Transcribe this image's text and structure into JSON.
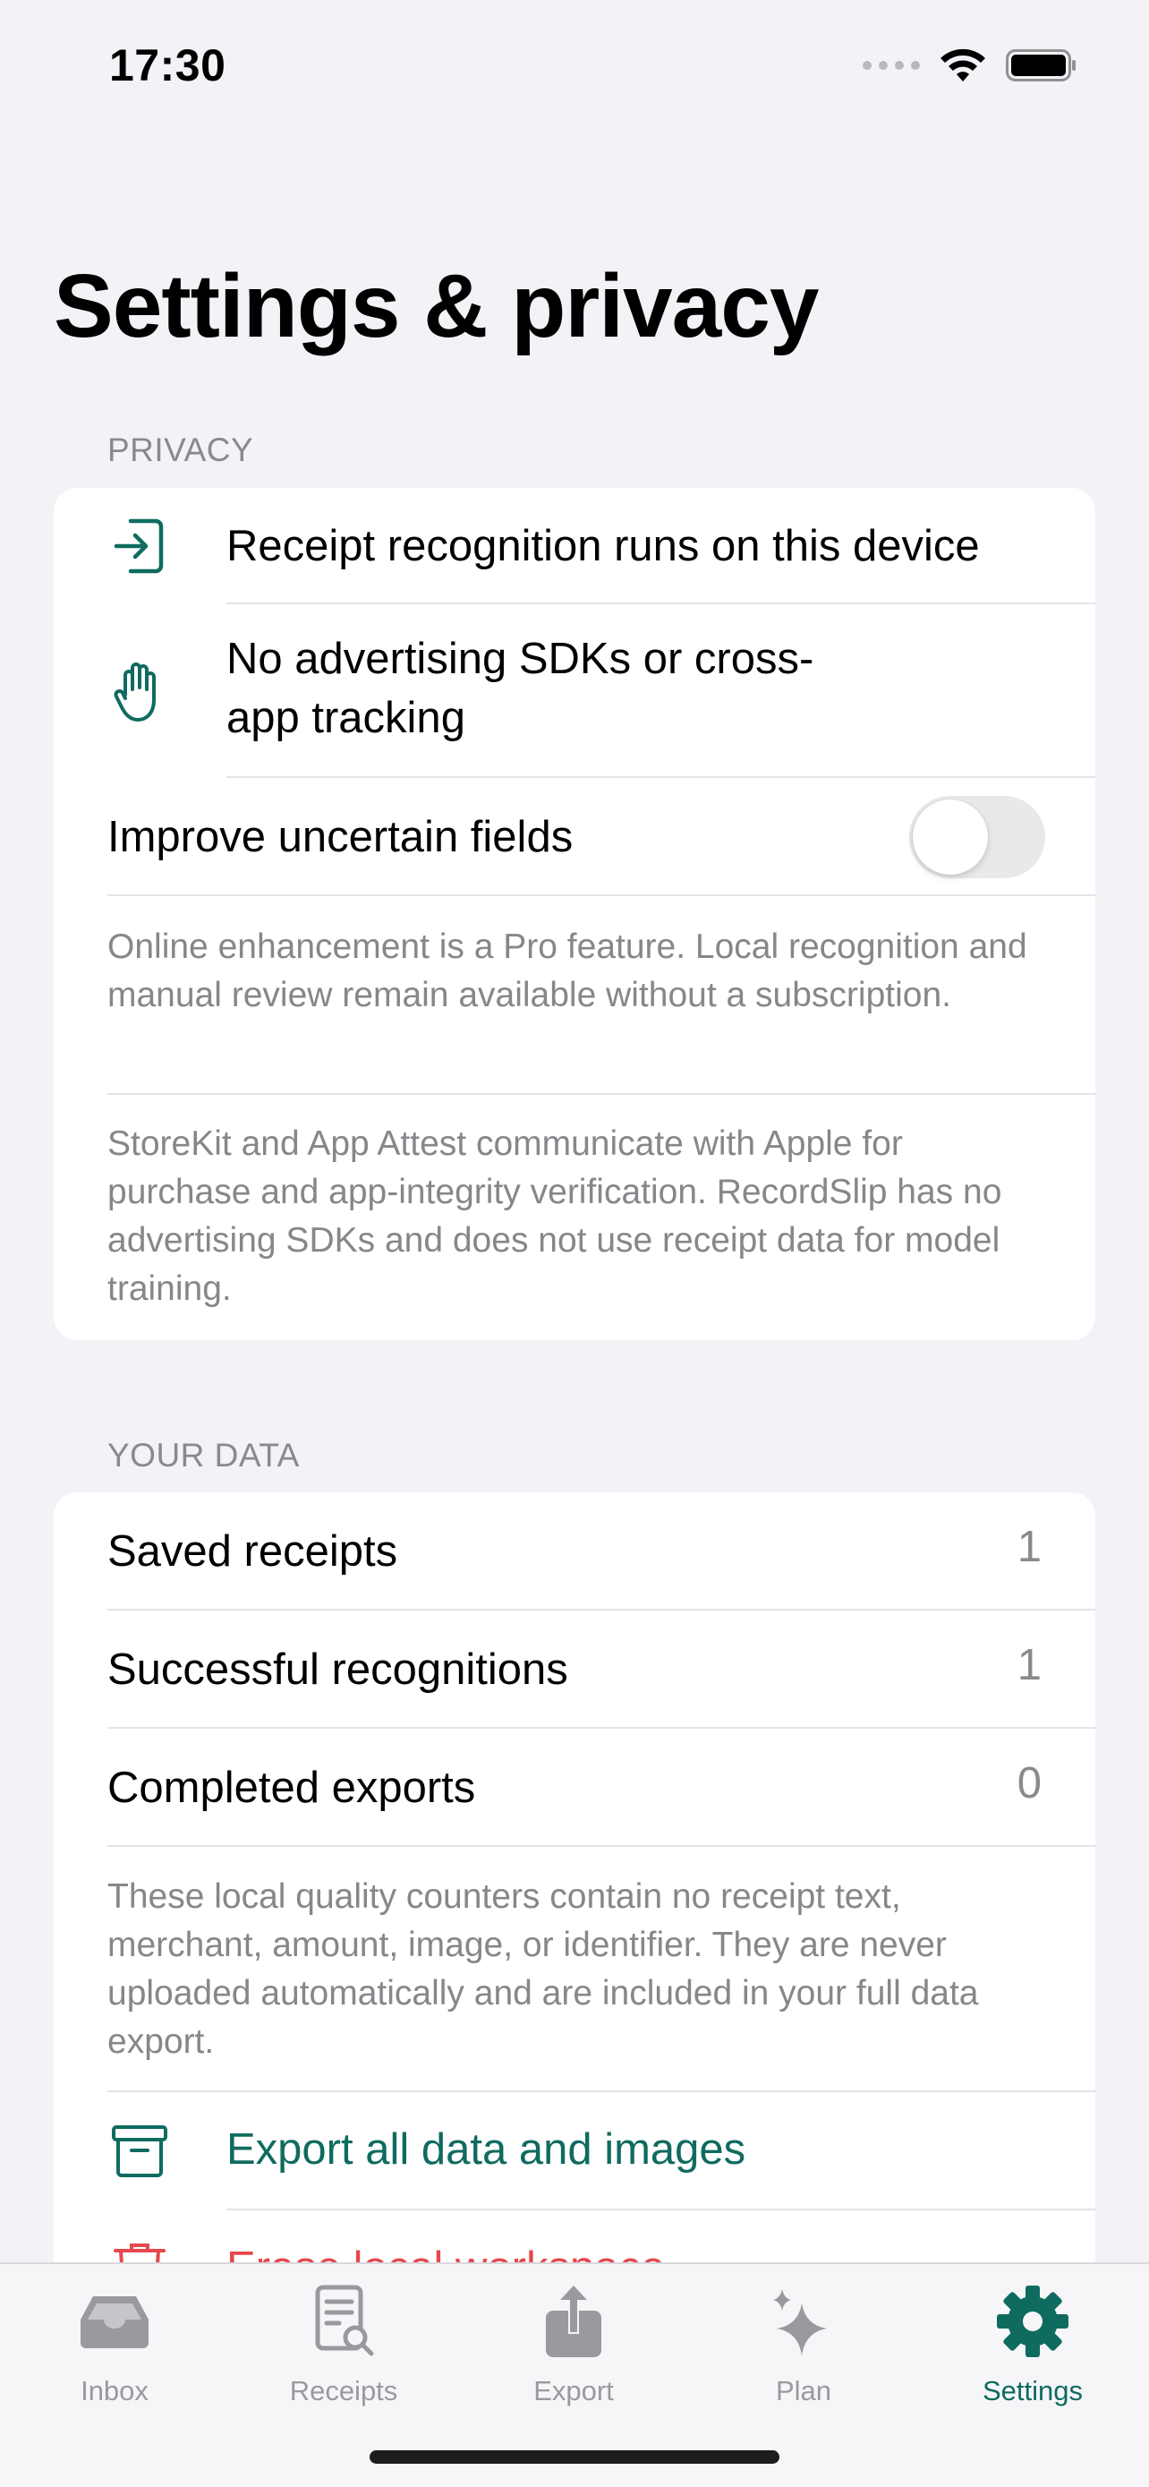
{
  "status_bar": {
    "time": "17:30"
  },
  "page": {
    "title": "Settings & privacy"
  },
  "privacy": {
    "header": "PRIVACY",
    "items": [
      {
        "icon": "device-entry-icon",
        "label": "Receipt recognition runs on this device"
      },
      {
        "icon": "hand-raised-icon",
        "label_line1": "No advertising SDKs or cross-",
        "label_line2": "app tracking"
      }
    ],
    "toggle": {
      "label": "Improve uncertain fields",
      "state": "off"
    },
    "note1": "Online enhancement is a Pro feature. Local recognition and manual review remain available without a subscription.",
    "note2": "StoreKit and App Attest communicate with Apple for purchase and app-integrity verification. RecordSlip has no advertising SDKs and does not use receipt data for model training."
  },
  "your_data": {
    "header": "YOUR DATA",
    "rows": [
      {
        "label": "Saved receipts",
        "value": "1"
      },
      {
        "label": "Successful recognitions",
        "value": "1"
      },
      {
        "label": "Completed exports",
        "value": "0"
      }
    ],
    "note": "These local quality counters contain no receipt text, merchant, amount, image, or identifier. They are never uploaded automatically and are included in your full data export.",
    "export_action": {
      "icon": "archive-box-icon",
      "label": "Export all data and images"
    },
    "erase_action": {
      "icon": "trash-icon",
      "label": "Erase local workspace"
    }
  },
  "tab_bar": {
    "active": "Settings",
    "tabs": [
      {
        "label": "Inbox",
        "icon": "tray-icon"
      },
      {
        "label": "Receipts",
        "icon": "receipt-search-icon"
      },
      {
        "label": "Export",
        "icon": "share-icon"
      },
      {
        "label": "Plan",
        "icon": "sparkles-icon"
      },
      {
        "label": "Settings",
        "icon": "gear-icon"
      }
    ]
  },
  "colors": {
    "accent": "#0f6b5f",
    "danger": "#e5484d",
    "background": "#f2f2f7",
    "secondary_text": "#8a8a8e"
  }
}
